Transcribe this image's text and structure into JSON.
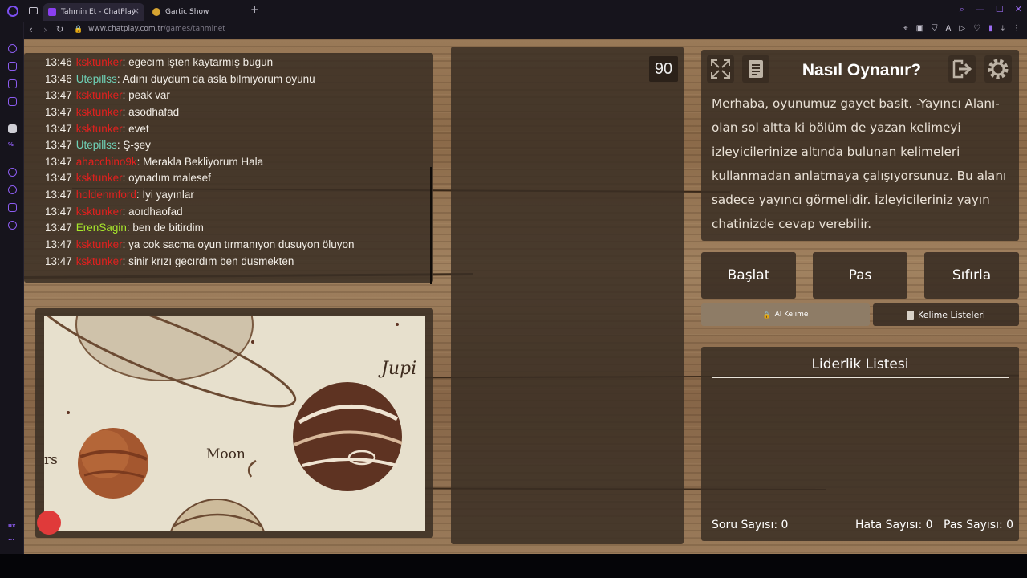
{
  "browser": {
    "tabs": [
      {
        "label": "Tahmin Et - ChatPlay",
        "favicon": "CP"
      },
      {
        "label": "Gartic Show"
      }
    ],
    "url_host": "www.chatplay.com.tr",
    "url_path": "/games/tahminet",
    "sidebar_label": "ux"
  },
  "chat": {
    "messages": [
      {
        "time": "13:46",
        "user": "ksktunker",
        "user_color": "#e0201e",
        "text": ": egecım işten kaytarmış bugun"
      },
      {
        "time": "13:46",
        "user": "Utepillss",
        "user_color": "#6fd1b7",
        "text": ": Adını duydum da asla bilmiyorum oyunu"
      },
      {
        "time": "13:47",
        "user": "ksktunker",
        "user_color": "#e0201e",
        "text": ": peak var"
      },
      {
        "time": "13:47",
        "user": "ksktunker",
        "user_color": "#e0201e",
        "text": ": asodhafad"
      },
      {
        "time": "13:47",
        "user": "ksktunker",
        "user_color": "#e0201e",
        "text": ": evet"
      },
      {
        "time": "13:47",
        "user": "Utepillss",
        "user_color": "#6fd1b7",
        "text": ": Ş-şey"
      },
      {
        "time": "13:47",
        "user": "ahacchino9k",
        "user_color": "#e0201e",
        "text": ": Merakla Bekliyorum Hala"
      },
      {
        "time": "13:47",
        "user": "ksktunker",
        "user_color": "#e0201e",
        "text": ": oynadım malesef"
      },
      {
        "time": "13:47",
        "user": "holdenmford",
        "user_color": "#e0201e",
        "text": ": İyi yayınlar"
      },
      {
        "time": "13:47",
        "user": "ksktunker",
        "user_color": "#e0201e",
        "text": ": aoıdhaofad"
      },
      {
        "time": "13:47",
        "user": "ErenSagin",
        "user_color": "#a8e82c",
        "text": ": ben de bitirdim"
      },
      {
        "time": "13:47",
        "user": "ksktunker",
        "user_color": "#e0201e",
        "text": ": ya cok sacma oyun tırmanıyon dusuyon öluyon"
      },
      {
        "time": "13:47",
        "user": "ksktunker",
        "user_color": "#e0201e",
        "text": ": sinir krızı gecırdım ben dusmekten"
      }
    ]
  },
  "image": {
    "labels": {
      "jupiter": "Jupi",
      "moon": "Moon",
      "mars": "rs"
    }
  },
  "timer": "90",
  "how_to_play": {
    "title": "Nasıl Oynanır?",
    "text": "Merhaba, oyunumuz gayet basit. -Yayıncı Alanı- olan sol altta ki bölüm de yazan kelimeyi izleyicilerinize altında bulunan kelimeleri kullanmadan anlatmaya çalışıyorsunuz. Bu alanı sadece yayıncı görmelidir. İzleyicileriniz yayın chatinizde cevap verebilir."
  },
  "controls": {
    "start": "Başlat",
    "pass": "Pas",
    "reset": "Sıfırla"
  },
  "word_tabs": {
    "get_word": "Al Kelime",
    "word_lists": "Kelime Listeleri"
  },
  "leaderboard": {
    "title": "Liderlik Listesi",
    "question_count_label": "Soru Sayısı:",
    "question_count": "0",
    "error_count_label": "Hata Sayısı:",
    "error_count": "0",
    "pass_count_label": "Pas Sayısı:",
    "pass_count": "0"
  },
  "colors": {
    "accent": "#8c5cf0",
    "panel": "#3a2e24",
    "user_red": "#e0201e",
    "user_teal": "#6fd1b7",
    "user_green": "#a8e82c"
  }
}
